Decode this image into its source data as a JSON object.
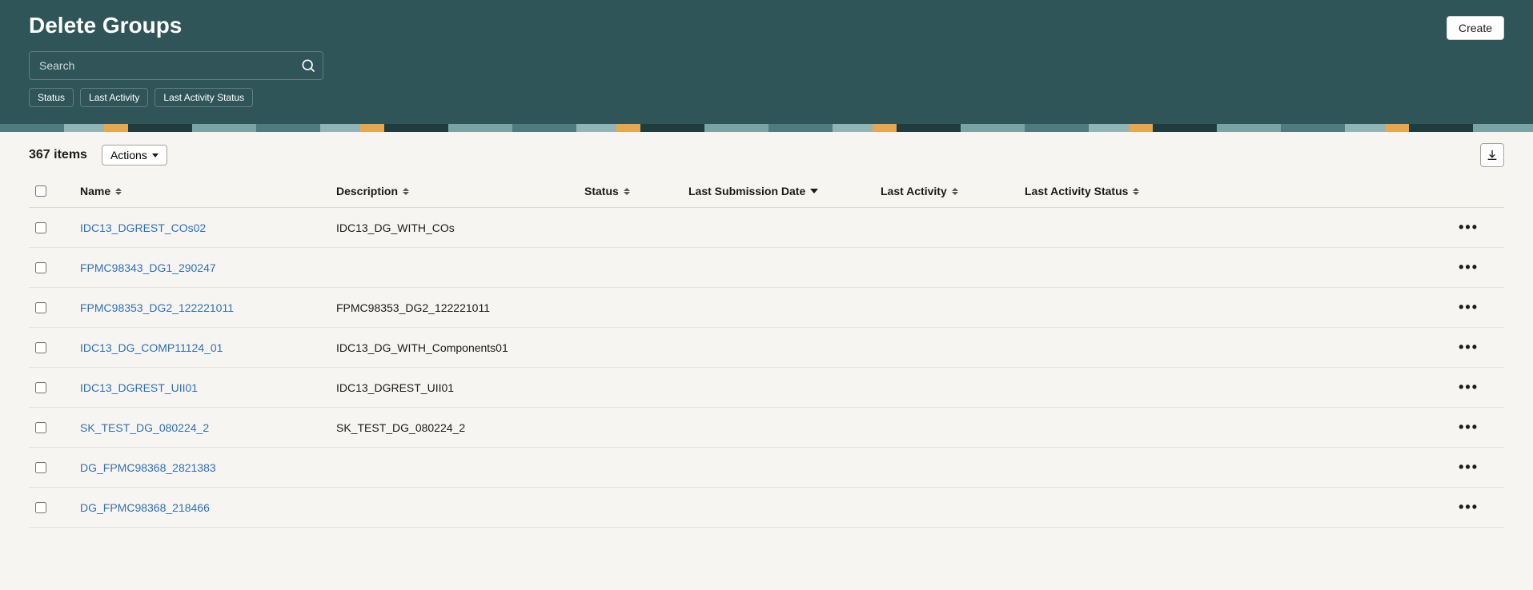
{
  "header": {
    "title": "Delete Groups",
    "create_label": "Create",
    "search_placeholder": "Search",
    "filters": [
      "Status",
      "Last Activity",
      "Last Activity Status"
    ]
  },
  "toolbar": {
    "count_text": "367 items",
    "actions_label": "Actions"
  },
  "table": {
    "columns": {
      "name": "Name",
      "description": "Description",
      "status": "Status",
      "submission": "Last Submission Date",
      "activity": "Last Activity",
      "activity_status": "Last Activity Status"
    },
    "rows": [
      {
        "name": "IDC13_DGREST_COs02",
        "description": "IDC13_DG_WITH_COs",
        "status": "",
        "submission": "",
        "activity": "",
        "activity_status": ""
      },
      {
        "name": "FPMC98343_DG1_290247",
        "description": "",
        "status": "",
        "submission": "",
        "activity": "",
        "activity_status": ""
      },
      {
        "name": "FPMC98353_DG2_122221011",
        "description": "FPMC98353_DG2_122221011",
        "status": "",
        "submission": "",
        "activity": "",
        "activity_status": ""
      },
      {
        "name": "IDC13_DG_COMP11124_01",
        "description": "IDC13_DG_WITH_Components01",
        "status": "",
        "submission": "",
        "activity": "",
        "activity_status": ""
      },
      {
        "name": "IDC13_DGREST_UII01",
        "description": "IDC13_DGREST_UII01",
        "status": "",
        "submission": "",
        "activity": "",
        "activity_status": ""
      },
      {
        "name": "SK_TEST_DG_080224_2",
        "description": "SK_TEST_DG_080224_2",
        "status": "",
        "submission": "",
        "activity": "",
        "activity_status": ""
      },
      {
        "name": "DG_FPMC98368_2821383",
        "description": "",
        "status": "",
        "submission": "",
        "activity": "",
        "activity_status": ""
      },
      {
        "name": "DG_FPMC98368_218466",
        "description": "",
        "status": "",
        "submission": "",
        "activity": "",
        "activity_status": ""
      }
    ]
  }
}
